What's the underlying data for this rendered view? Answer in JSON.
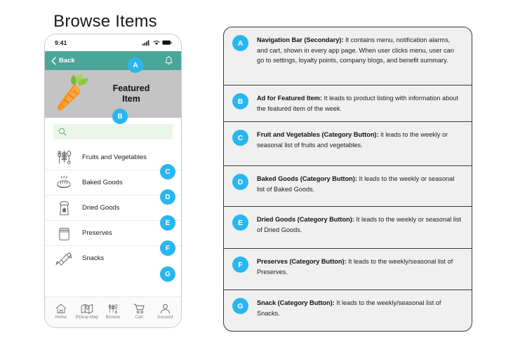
{
  "page_title": "Browse Items",
  "colors": {
    "accent_teal": "#4aa698",
    "badge_blue": "#29b6f0",
    "banner_gray": "#c4c4c4",
    "search_green": "#eaf6ea",
    "panel_gray": "#f0f0f0"
  },
  "phone": {
    "status_bar": {
      "time": "9:41",
      "signal_icon": "cellular-signal-icon",
      "wifi_icon": "wifi-icon",
      "battery_icon": "battery-icon"
    },
    "nav_bar": {
      "back_label": "Back",
      "back_icon": "chevron-left-icon",
      "bell_icon": "notification-bell-icon"
    },
    "featured": {
      "label": "Featured Item",
      "image_icon": "carrot-icon"
    },
    "search": {
      "value": "",
      "placeholder": "",
      "icon": "search-icon"
    },
    "categories": [
      {
        "label": "Fruits and Vegetables",
        "icon": "fruits-vegetables-icon",
        "badge": "C"
      },
      {
        "label": "Baked Goods",
        "icon": "bread-loaf-icon",
        "badge": "D"
      },
      {
        "label": "Dried Goods",
        "icon": "grain-sack-icon",
        "badge": "E"
      },
      {
        "label": "Preserves",
        "icon": "jam-jar-icon",
        "badge": "F"
      },
      {
        "label": "Snacks",
        "icon": "snack-bar-icon",
        "badge": "G"
      }
    ],
    "tabs": [
      {
        "label": "Home",
        "icon": "home-icon"
      },
      {
        "label": "Pickup Map",
        "icon": "map-pin-icon"
      },
      {
        "label": "Browse",
        "icon": "browse-produce-icon"
      },
      {
        "label": "Cart",
        "icon": "shopping-cart-icon"
      },
      {
        "label": "Account",
        "icon": "person-icon"
      }
    ],
    "badges": {
      "a": "A",
      "b": "B"
    }
  },
  "legend": [
    {
      "badge": "A",
      "title": "Navigation Bar (Secondary):",
      "body": " It contains menu, notification alarms, and cart, shown in every app page. When user clicks menu, user can go to settings, loyalty points, company blogs, and benefit summary."
    },
    {
      "badge": "B",
      "title": "Ad for Featured Item:",
      "body": " It leads to product listing with information about the featured item of the week."
    },
    {
      "badge": "C",
      "title": "Fruit and Vegetables (Category Button):",
      "body": " it leads to the weekly or seasonal list of fruits and vegetables."
    },
    {
      "badge": "D",
      "title": "Baked Goods (Category Button):",
      "body": " It leads to the weekly or seasonal list of Baked Goods."
    },
    {
      "badge": "E",
      "title": "Dried Goods (Category Button):",
      "body": " It leads to the weekly or seasonal list of Dried Goods."
    },
    {
      "badge": "F",
      "title": "Preserves (Category Button):",
      "body": "  It leads to the weekly/seasonal list of Preserves."
    },
    {
      "badge": "G",
      "title": "Snack (Category Button):",
      "body": " It leads to the weekly/seasonal list of Snacks."
    }
  ]
}
